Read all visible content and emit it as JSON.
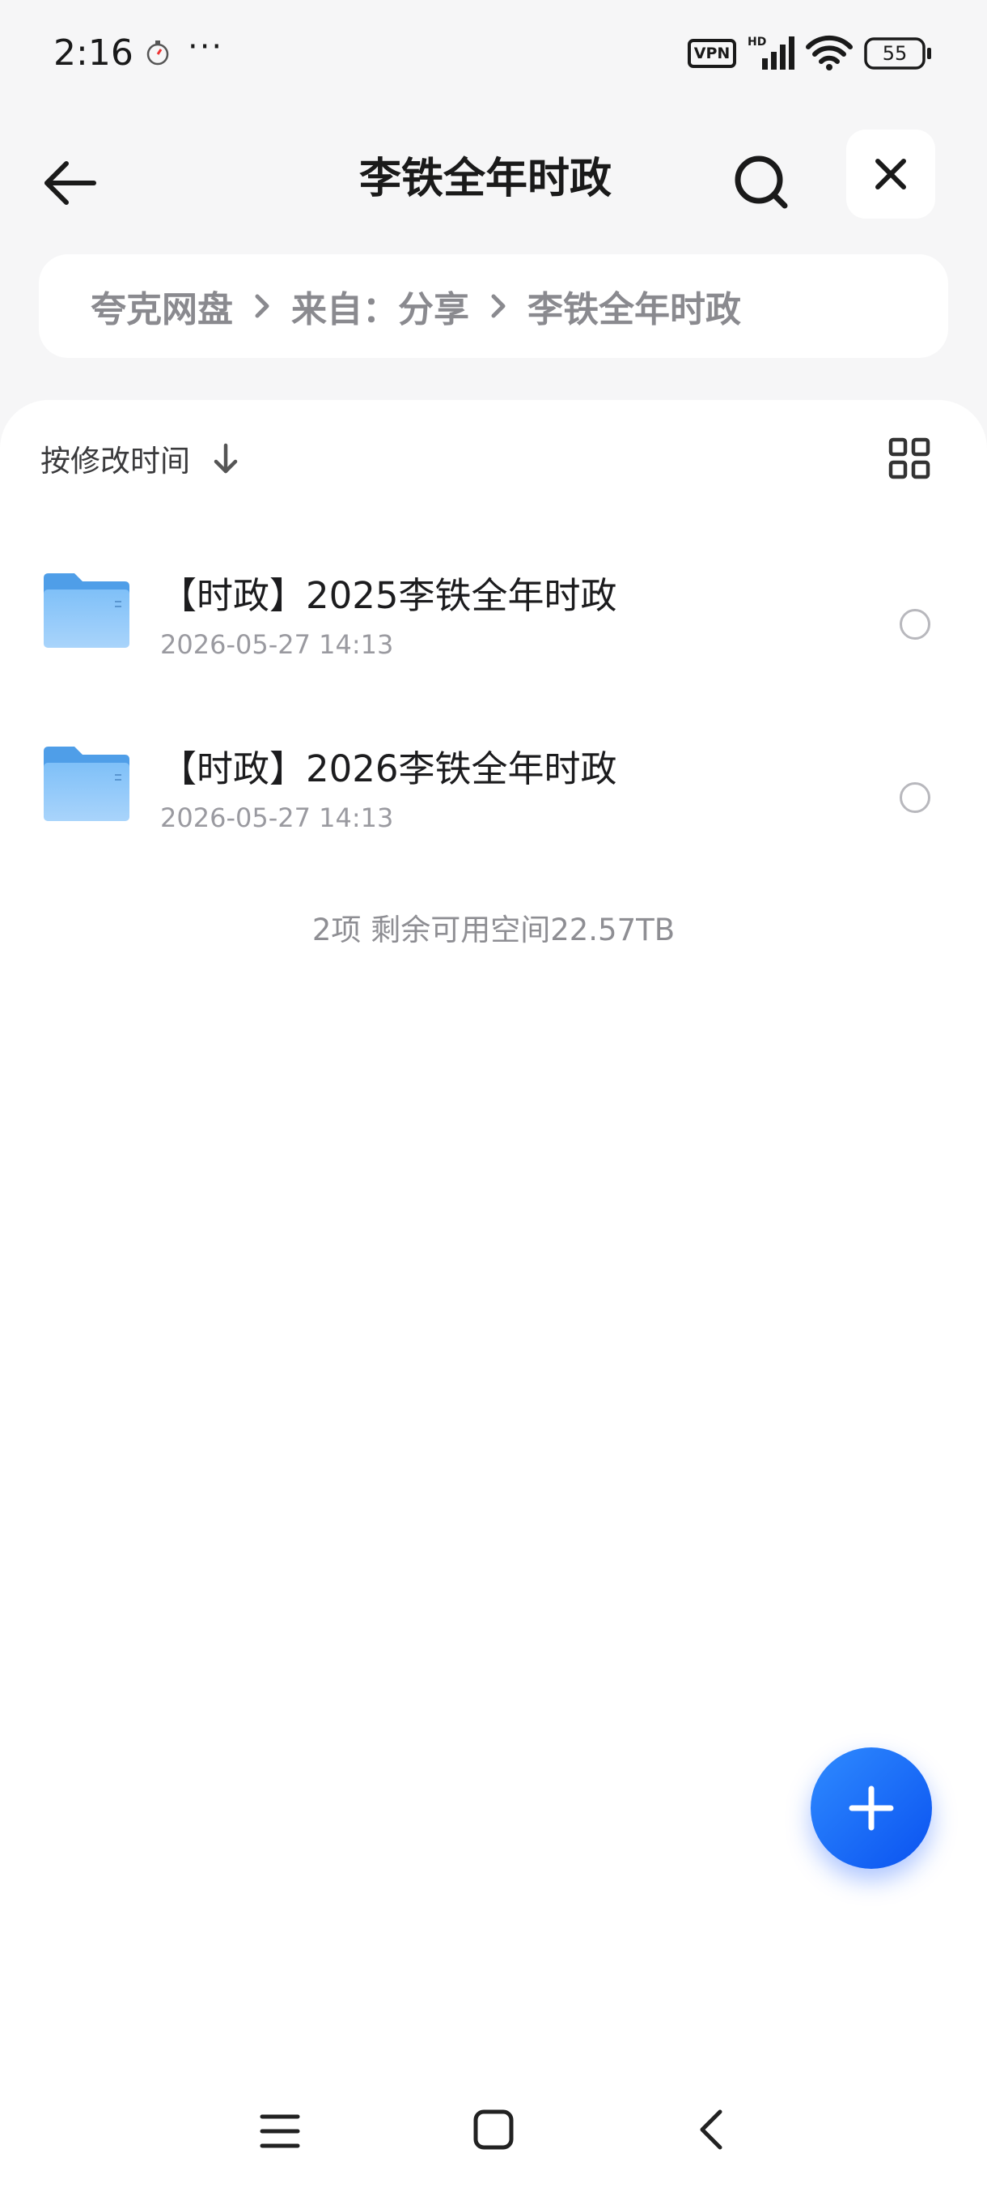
{
  "status_bar": {
    "time": "2:16",
    "more": "···",
    "vpn_label": "VPN",
    "network_label": "HD",
    "battery_level": "55",
    "icons": [
      "stopwatch-icon",
      "vpn-icon",
      "signal-icon",
      "wifi-icon",
      "battery-icon"
    ]
  },
  "header": {
    "title": "李铁全年时政",
    "icons": [
      "back-arrow-icon",
      "search-icon",
      "close-icon"
    ]
  },
  "breadcrumb": {
    "items": [
      "夸克网盘",
      "来自：分享",
      "李铁全年时政"
    ]
  },
  "sort_bar": {
    "label": "按修改时间",
    "direction": "descending",
    "icons": [
      "arrow-down-icon",
      "grid-view-icon"
    ]
  },
  "files": [
    {
      "name": "【时政】2025李铁全年时政",
      "date": "2026-05-27 14:13",
      "type": "folder"
    },
    {
      "name": "【时政】2026李铁全年时政",
      "date": "2026-05-27 14:13",
      "type": "folder"
    }
  ],
  "summary": "2项 剩余可用空间22.57TB",
  "fab": {
    "icon": "plus-icon"
  },
  "nav_bar": {
    "icons": [
      "menu-icon",
      "home-icon",
      "back-icon"
    ]
  },
  "colors": {
    "accent": "#1565FF",
    "folder": "#6CB4F5",
    "background": "#F6F6F7",
    "panel": "#FFFFFF",
    "secondary_text": "#8E8E93"
  }
}
